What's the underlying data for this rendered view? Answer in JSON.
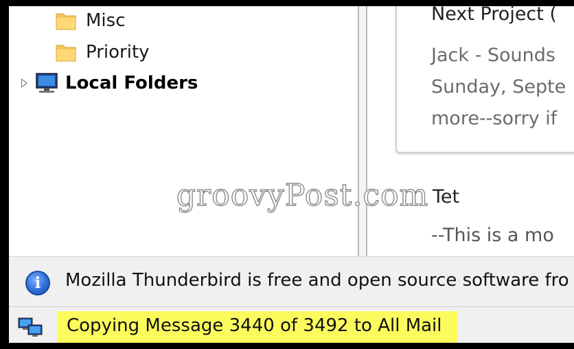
{
  "folder_tree": {
    "items": [
      {
        "label": "Misc",
        "icon": "folder-icon"
      },
      {
        "label": "Priority",
        "icon": "folder-icon"
      },
      {
        "label": "Local Folders",
        "icon": "computer-icon",
        "expander": "collapsed-arrow-icon"
      }
    ]
  },
  "preview": {
    "subject": "Next Project (",
    "body_lines": [
      "Jack - Sounds",
      "Sunday, Septe",
      "more--sorry if"
    ],
    "second_message_title": "Tet",
    "second_message_line": "--This is a mo"
  },
  "watermark": "groovyPost.com",
  "notification_bar": {
    "icon": "info-icon",
    "icon_glyph": "i",
    "text": "Mozilla Thunderbird is free and open source software fro"
  },
  "status_bar": {
    "icon": "network-activity-icon",
    "text": "Copying Message 3440 of 3492 to All Mail",
    "highlight_color": "#fbfb5e"
  }
}
